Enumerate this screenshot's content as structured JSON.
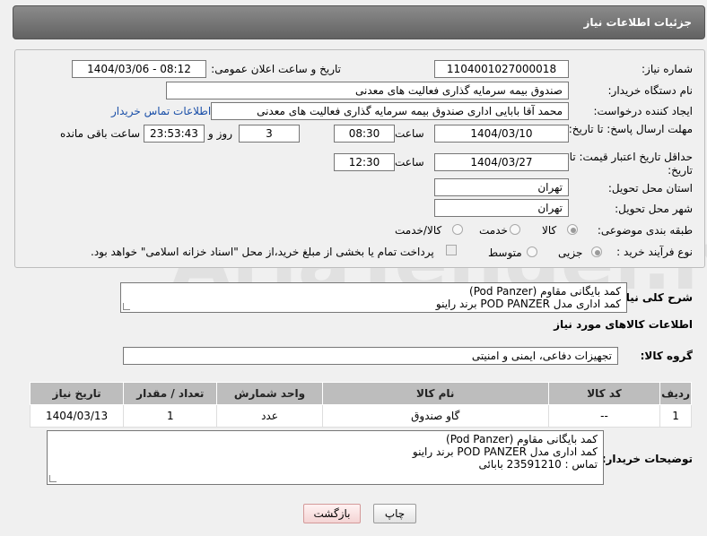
{
  "header": {
    "title": "جزئیات اطلاعات نیاز"
  },
  "watermark": "AriaTender.neT",
  "form": {
    "need_number_label": "شماره نیاز:",
    "need_number": "1104001027000018",
    "announce_label": "تاریخ و ساعت اعلان عمومی:",
    "announce_value": "1404/03/06 - 08:12",
    "buyer_org_label": "نام دستگاه خریدار:",
    "buyer_org": "صندوق بیمه سرمایه گذاری فعالیت های معدنی",
    "creator_label": "ایجاد کننده درخواست:",
    "creator": "محمد آقا بابایی اداری صندوق بیمه سرمایه گذاری فعالیت های معدنی",
    "contact_link": "اطلاعات تماس خریدار",
    "reply_deadline_label": "مهلت ارسال پاسخ: تا تاریخ:",
    "reply_date": "1404/03/10",
    "time_label": "ساعت",
    "reply_time": "08:30",
    "days_value": "3",
    "days_label": "روز و",
    "remaining_value": "23:53:43",
    "remaining_label": "ساعت باقی مانده",
    "price_validity_label": "حداقل تاریخ اعتبار قیمت: تا تاریخ:",
    "price_date": "1404/03/27",
    "price_time": "12:30",
    "province_label": "استان محل تحویل:",
    "province": "تهران",
    "city_label": "شهر محل تحویل:",
    "city": "تهران",
    "category_label": "طبقه بندی موضوعی:",
    "category_options": [
      "کالا",
      "خدمت",
      "کالا/خدمت"
    ],
    "process_label": "نوع فرآیند خرید :",
    "process_options": [
      "جزیی",
      "متوسط"
    ],
    "payment_note": "پرداخت تمام یا بخشی از مبلغ خرید،از محل \"اسناد خزانه اسلامی\" خواهد بود."
  },
  "description": {
    "label": "شرح کلی نیاز:",
    "lines": [
      "کمد بایگانی مقاوم (Pod Panzer)",
      "کمد اداری مدل POD PANZER برند راینو"
    ]
  },
  "goods": {
    "section_title": "اطلاعات کالاهای مورد نیاز",
    "group_label": "گروه کالا:",
    "group_value": "تجهیزات دفاعی، ایمنی و امنیتی",
    "columns": [
      "ردیف",
      "کد کالا",
      "نام کالا",
      "واحد شمارش",
      "تعداد / مقدار",
      "تاریخ نیاز"
    ],
    "rows": [
      {
        "row": "1",
        "code": "--",
        "name": "گاو صندوق",
        "unit": "عدد",
        "qty": "1",
        "date": "1404/03/13"
      }
    ]
  },
  "buyer_notes": {
    "label": "توضیحات خریدار:",
    "lines": [
      "کمد بایگانی مقاوم (Pod Panzer)",
      "کمد اداری مدل POD PANZER برند راینو",
      "تماس : 23591210 بابائی"
    ]
  },
  "buttons": {
    "print": "چاپ",
    "back": "بازگشت"
  }
}
